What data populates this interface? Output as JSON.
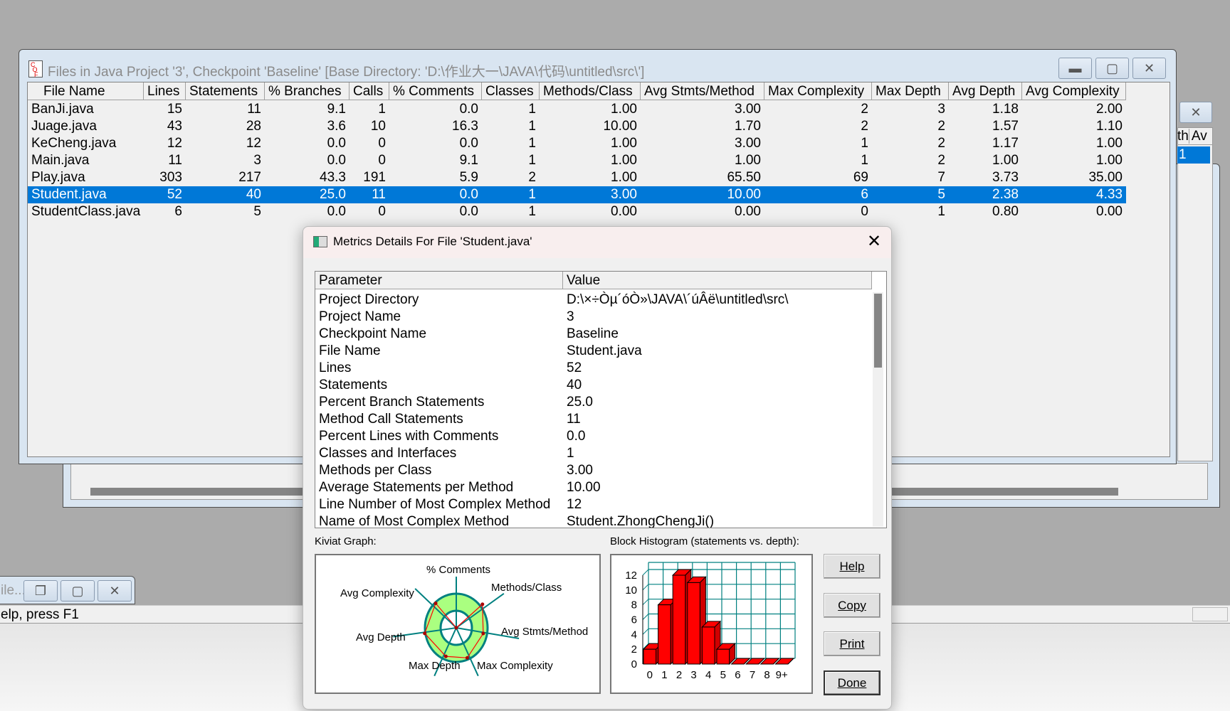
{
  "main_window": {
    "title": "Files in Java Project '3', Checkpoint 'Baseline'  [Base Directory: 'D:\\作业大一\\JAVA\\代码\\untitled\\src\\']",
    "columns": [
      "File Name",
      "Lines",
      "Statements",
      "% Branches",
      "Calls",
      "% Comments",
      "Classes",
      "Methods/Class",
      "Avg Stmts/Method",
      "Max Complexity",
      "Max Depth",
      "Avg Depth",
      "Avg Complexity"
    ],
    "sort_column": "File Name",
    "sort_direction": "ascending",
    "rows": [
      [
        "BanJi.java",
        "15",
        "11",
        "9.1",
        "1",
        "0.0",
        "1",
        "1.00",
        "3.00",
        "2",
        "3",
        "1.18",
        "2.00"
      ],
      [
        "Juage.java",
        "43",
        "28",
        "3.6",
        "10",
        "16.3",
        "1",
        "10.00",
        "1.70",
        "2",
        "2",
        "1.57",
        "1.10"
      ],
      [
        "KeCheng.java",
        "12",
        "12",
        "0.0",
        "0",
        "0.0",
        "1",
        "1.00",
        "3.00",
        "1",
        "2",
        "1.17",
        "1.00"
      ],
      [
        "Main.java",
        "11",
        "3",
        "0.0",
        "0",
        "9.1",
        "1",
        "1.00",
        "1.00",
        "1",
        "2",
        "1.00",
        "1.00"
      ],
      [
        "Play.java",
        "303",
        "217",
        "43.3",
        "191",
        "5.9",
        "2",
        "1.00",
        "65.50",
        "69",
        "7",
        "3.73",
        "35.00"
      ],
      [
        "Student.java",
        "52",
        "40",
        "25.0",
        "11",
        "0.0",
        "1",
        "3.00",
        "10.00",
        "6",
        "5",
        "2.38",
        "4.33"
      ],
      [
        "StudentClass.java",
        "6",
        "5",
        "0.0",
        "0",
        "0.0",
        "1",
        "0.00",
        "0.00",
        "0",
        "1",
        "0.80",
        "0.00"
      ]
    ],
    "selected_row": 5
  },
  "back_window": {
    "header_fragments": [
      "th",
      "Av"
    ],
    "selected_cell": "1"
  },
  "minimized_window": {
    "title": "ile..."
  },
  "status_bar": {
    "text": "elp, press F1"
  },
  "colors": {
    "selection": "#0078d7",
    "histogram_bar": "#ff0000",
    "kiviat_ring": "#aaff80",
    "grid_line": "#008080"
  },
  "dialog": {
    "title": "Metrics Details For File 'Student.java'",
    "columns": [
      "Parameter",
      "Value"
    ],
    "rows": [
      [
        "Project Directory",
        "D:\\×÷Òµ´óÒ»\\JAVA\\´úÂë\\untitled\\src\\"
      ],
      [
        "Project Name",
        "3"
      ],
      [
        "Checkpoint Name",
        "Baseline"
      ],
      [
        "File Name",
        "Student.java"
      ],
      [
        "Lines",
        "52"
      ],
      [
        "Statements",
        "40"
      ],
      [
        "Percent Branch Statements",
        "25.0"
      ],
      [
        "Method Call Statements",
        "11"
      ],
      [
        "Percent Lines with Comments",
        "0.0"
      ],
      [
        "Classes and Interfaces",
        "1"
      ],
      [
        "Methods per Class",
        "3.00"
      ],
      [
        "Average Statements per Method",
        "10.00"
      ],
      [
        "Line Number of Most Complex Method",
        "12"
      ],
      [
        "Name of Most Complex Method",
        "Student.ZhongChengJi()"
      ]
    ],
    "kiviat_label": "Kiviat Graph:",
    "kiviat_axes": [
      "% Comments",
      "Methods/Class",
      "Avg Stmts/Method",
      "Max Complexity",
      "Max Depth",
      "Avg Depth",
      "Avg Complexity"
    ],
    "histogram_label": "Block Histogram (statements vs. depth):",
    "buttons": {
      "help": "Help",
      "copy": "Copy",
      "print": "Print",
      "done": "Done"
    }
  },
  "chart_data": {
    "type": "bar",
    "title": "Block Histogram (statements vs. depth):",
    "categories": [
      "0",
      "1",
      "2",
      "3",
      "4",
      "5",
      "6",
      "7",
      "8",
      "9+"
    ],
    "values": [
      2,
      8,
      12,
      11,
      5,
      2,
      0,
      0,
      0,
      0
    ],
    "yticks": [
      "0",
      "2",
      "4",
      "6",
      "8",
      "10",
      "12"
    ],
    "ylim": [
      0,
      12
    ],
    "grid": true
  }
}
